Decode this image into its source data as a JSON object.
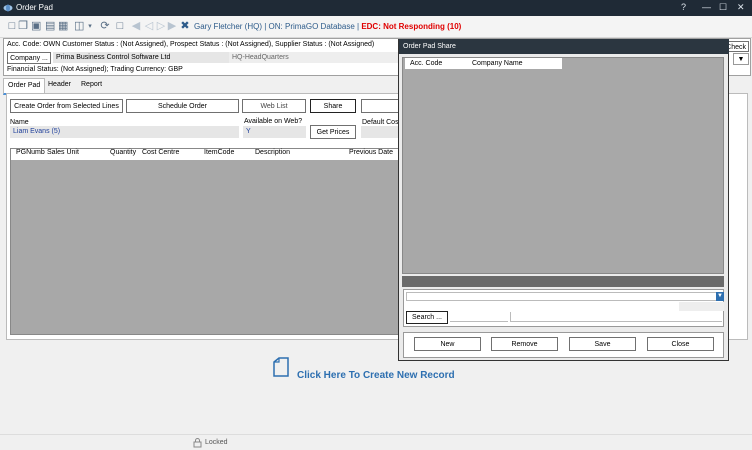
{
  "window": {
    "title": "Order Pad",
    "help": "?",
    "minimize": "—",
    "maximize": "☐",
    "close": "✕"
  },
  "toolbar": {
    "user_text": "Gary Fletcher (HQ) | ON: PrimaGO Database | ",
    "edc_text": "EDC: Not Responding  (10)"
  },
  "info": {
    "line1": "Acc. Code: OWN  Customer Status : (Not Assigned), Prospect Status : (Not Assigned), Supplier Status : (Not Assigned)",
    "company_button": "Company ...",
    "company_value": "Prima Business Control Software Ltd",
    "branch_value": "HQ-HeadQuarters",
    "line3": "Financial Status: (Not Assigned); Trading Currency: GBP",
    "check_button": "Check"
  },
  "tabs": [
    {
      "label": "Order Pad",
      "active": true
    },
    {
      "label": "Header"
    },
    {
      "label": "Report"
    }
  ],
  "orderpad": {
    "create_button": "Create Order from Selected Lines",
    "schedule_button": "Schedule Order",
    "weblist_button": "Web List",
    "share_button": "Share",
    "name_label": "Name",
    "name_value": "Liam Evans (5)",
    "available_label": "Available on Web?",
    "available_value": "Y",
    "get_prices_button": "Get Prices",
    "default_cost_label": "Default Cost",
    "columns": [
      "PGNumb",
      "Sales Unit",
      "Quantity",
      "Cost Centre",
      "ItemCode",
      "Description",
      "Previous Date"
    ]
  },
  "create_record": "Click Here To Create New Record",
  "status": {
    "lock_text": "Locked"
  },
  "dialog": {
    "title": "Order Pad Share",
    "columns": [
      "Acc. Code",
      "Company Name"
    ],
    "search_button": "Search ...",
    "buttons": {
      "new": "New",
      "remove": "Remove",
      "save": "Save",
      "close": "Close"
    }
  },
  "colors": {
    "title_bar": "#1f2a36",
    "edc_red": "#e00000",
    "link_blue": "#2d6fb0",
    "grid_gray": "#a8a8a8"
  }
}
